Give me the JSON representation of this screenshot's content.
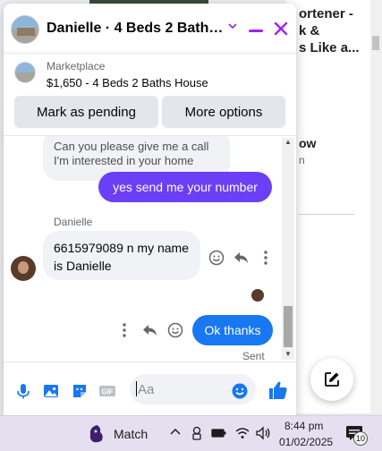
{
  "background_page": {
    "snippet_title": "ortener -\nk &\ns Like a...",
    "snippet_subtitle": "ow",
    "snippet_meta": "n"
  },
  "chat": {
    "header_title": "Danielle · 4 Beds 2 Baths H...",
    "marketplace_label": "Marketplace",
    "listing_title": "$1,650 - 4 Beds 2 Baths House",
    "mark_pending_label": "Mark as pending",
    "more_options_label": "More options",
    "messages": [
      {
        "from": "them",
        "text": "Can you please give me a call I'm interested in your home"
      },
      {
        "from": "me",
        "text": "yes send me your number"
      },
      {
        "from": "them",
        "sender": "Danielle",
        "text": "6615979089 n my name is Danielle"
      },
      {
        "from": "me",
        "text": "Ok thanks"
      }
    ],
    "sent_status": "Sent",
    "composer_placeholder": "Aa"
  },
  "taskbar": {
    "app_label": "Match",
    "time": "8:44 pm",
    "date": "01/02/2025",
    "notification_count": "10"
  }
}
